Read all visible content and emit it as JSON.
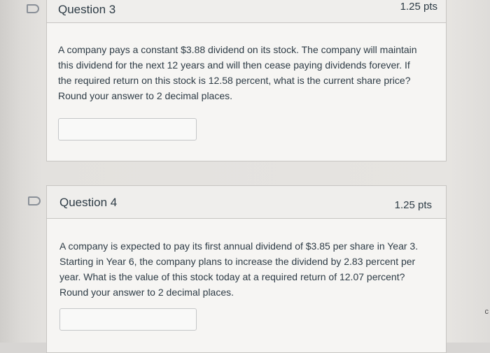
{
  "questions": [
    {
      "title": "Question 3",
      "points": "1.25 pts",
      "lines": [
        "A company pays a constant $3.88 dividend on its stock. The company will maintain",
        "this dividend for the next 12 years and will then cease paying dividends forever.  If",
        "the required return on this stock is 12.58 percent, what is the current share price?",
        "Round your answer to 2 decimal places."
      ],
      "answer_value": ""
    },
    {
      "title": "Question 4",
      "points": "1.25 pts",
      "lines": [
        "A company is expected to pay its first annual dividend of $3.85 per share in Year 3.",
        "Starting in Year 6, the company plans to increase the dividend by 2.83 percent per",
        "year. What is the value of this stock today at a required return of 12.07 percent?",
        "Round your answer to 2 decimal places."
      ],
      "answer_value": ""
    }
  ],
  "edge_glyph": "c",
  "icons": {
    "flag": "bookmark-flag-icon"
  },
  "colors": {
    "text": "#2d3b45",
    "border": "#c7c5c2",
    "background": "#e6e4e1"
  }
}
